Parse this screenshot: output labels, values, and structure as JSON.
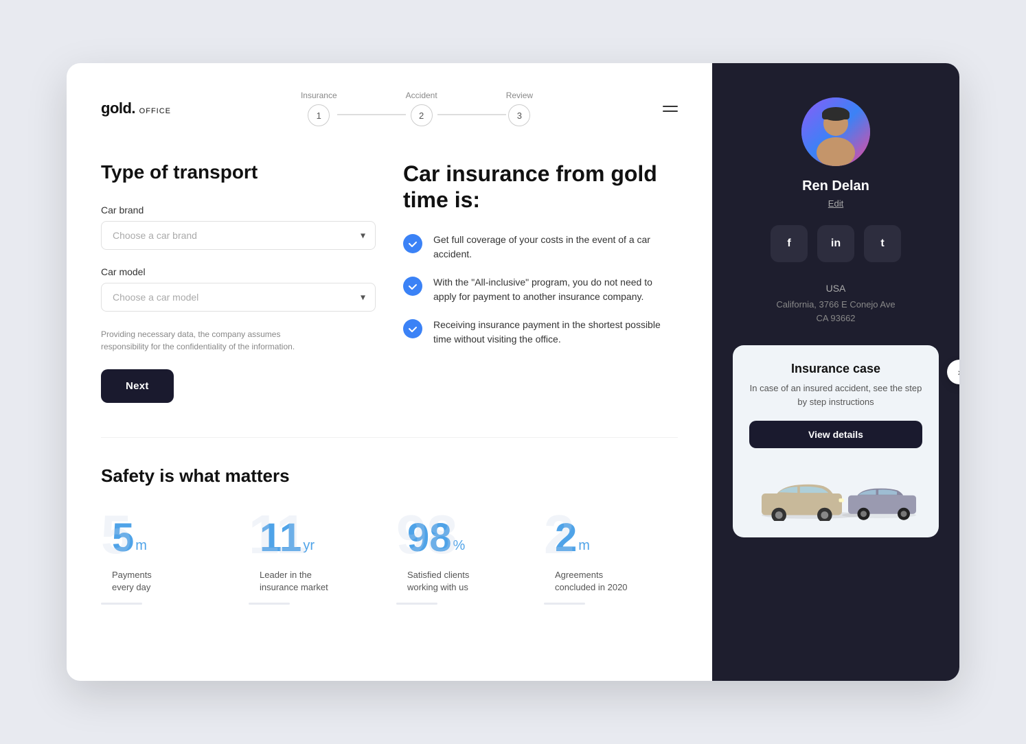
{
  "logo": {
    "text": "gold.",
    "sub": "OFFICE"
  },
  "stepper": {
    "steps": [
      {
        "label": "Insurance",
        "number": "1"
      },
      {
        "label": "Accident",
        "number": "2"
      },
      {
        "label": "Review",
        "number": "3"
      }
    ]
  },
  "form": {
    "title": "Type of transport",
    "car_brand_label": "Car brand",
    "car_brand_placeholder": "Choose a car brand",
    "car_model_label": "Car model",
    "car_model_placeholder": "Choose a car model",
    "privacy_note": "Providing necessary data, the company assumes responsibility for the confidentiality of the information.",
    "next_button": "Next"
  },
  "info": {
    "title": "Car insurance from gold time is:",
    "features": [
      "Get full coverage of your costs in the event of a car accident.",
      "With the \"All-inclusive\" program, you do not need to apply for payment to another insurance company.",
      "Receiving insurance payment in the shortest possible time without visiting the office."
    ]
  },
  "stats": {
    "section_title": "Safety is what matters",
    "items": [
      {
        "number": "5",
        "suffix": "m",
        "label": "Payments\nevery day"
      },
      {
        "number": "11",
        "suffix": "yr",
        "label": "Leader in the\ninsurance market"
      },
      {
        "number": "98",
        "suffix": "%",
        "label": "Satisfied clients\nworking with us"
      },
      {
        "number": "2",
        "suffix": "m",
        "label": "Agreements\nconcluded in 2020"
      }
    ]
  },
  "profile": {
    "name": "Ren Delan",
    "edit_label": "Edit",
    "country": "USA",
    "address": "California, 3766 E Conejo Ave",
    "zip": "CA 93662"
  },
  "social": {
    "facebook": "f",
    "linkedin": "in",
    "twitter": "t"
  },
  "insurance_case": {
    "title": "Insurance case",
    "description": "In case of an insured accident, see the step by step instructions",
    "button_label": "View details"
  }
}
